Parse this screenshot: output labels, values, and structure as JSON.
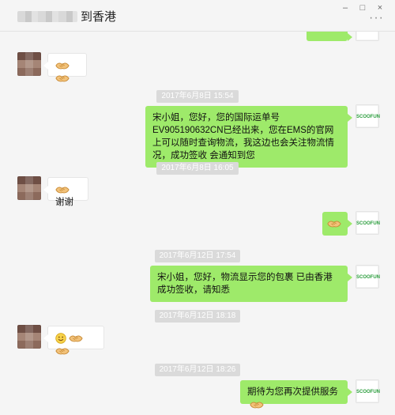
{
  "window": {
    "title": "到香港",
    "controls": {
      "minimize": "–",
      "maximize": "□",
      "close": "×"
    },
    "more": "···"
  },
  "messages": {
    "m1": {
      "sender": "contact",
      "emojis": [
        "handshake-icon",
        "handshake-icon"
      ]
    },
    "t1": "2017年6月8日 15:54",
    "m2": {
      "sender": "self",
      "text": "宋小姐，您好，您的国际运单号EV905190632CN已经出来，您在EMS的官网上可以随时查询物流，我这边也会关注物流情况，成功签收 会通知到您"
    },
    "t2": "2017年6月8日 16:05",
    "m3": {
      "sender": "contact",
      "text": "谢谢",
      "emojis": [
        "handshake-icon"
      ]
    },
    "m4": {
      "sender": "self",
      "emojis": [
        "handshake-icon"
      ]
    },
    "t3": "2017年6月12日 17:54",
    "m5": {
      "sender": "self",
      "text": "宋小姐，您好，物流显示您的包裹 已由香港成功签收，请知悉"
    },
    "t4": "2017年6月12日 18:18",
    "m6": {
      "sender": "contact",
      "emojis": [
        "smile-icon",
        "handshake-icon",
        "handshake-icon"
      ]
    },
    "t5": "2017年6月12日 18:26",
    "m7": {
      "sender": "self",
      "text": "期待为您再次提供服务",
      "emojis": [
        "handshake-icon"
      ]
    }
  },
  "self_avatar": {
    "label": "SCOOFUN",
    "color": "#2a9d3c"
  },
  "colors": {
    "self_bubble": "#9eea6a",
    "contact_bubble": "#ffffff",
    "background": "#f5f5f5"
  }
}
